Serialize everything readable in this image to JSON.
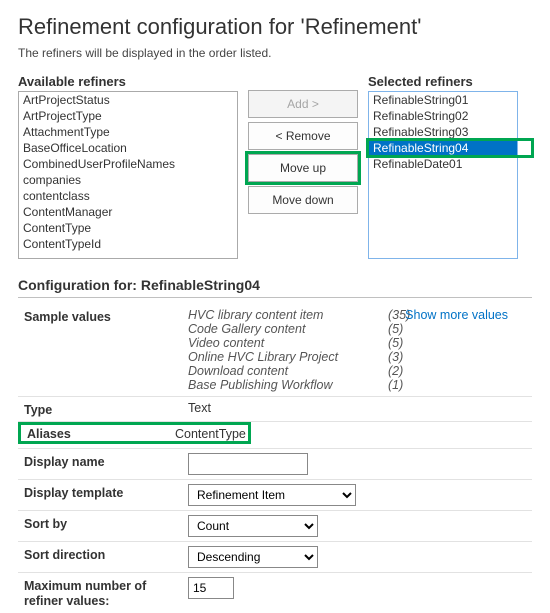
{
  "title": "Refinement configuration for 'Refinement'",
  "subtitle": "The refiners will be displayed in the order listed.",
  "picker": {
    "available_label": "Available refiners",
    "selected_label": "Selected refiners",
    "available": [
      "ArtProjectStatus",
      "ArtProjectType",
      "AttachmentType",
      "BaseOfficeLocation",
      "CombinedUserProfileNames",
      "companies",
      "contentclass",
      "ContentManager",
      "ContentType",
      "ContentTypeId"
    ],
    "selected": [
      "RefinableString01",
      "RefinableString02",
      "RefinableString03",
      "RefinableString04",
      "RefinableDate01"
    ],
    "selected_index": 3,
    "buttons": {
      "add": "Add >",
      "remove": "< Remove",
      "move_up": "Move up",
      "move_down": "Move down"
    }
  },
  "config": {
    "heading_prefix": "Configuration for:",
    "heading_value": "RefinableString04",
    "show_more": "Show more values",
    "labels": {
      "sample_values": "Sample values",
      "type": "Type",
      "aliases": "Aliases",
      "display_name": "Display name",
      "display_template": "Display template",
      "sort_by": "Sort by",
      "sort_direction": "Sort direction",
      "max_refiner": "Maximum number of refiner values:"
    },
    "samples": [
      {
        "name": "HVC library content item",
        "count": "(35)"
      },
      {
        "name": "Code Gallery content",
        "count": "(5)"
      },
      {
        "name": "Video content",
        "count": "(5)"
      },
      {
        "name": "Online HVC Library Project",
        "count": "(3)"
      },
      {
        "name": "Download content",
        "count": "(2)"
      },
      {
        "name": "Base Publishing Workflow",
        "count": "(1)"
      }
    ],
    "type_value": "Text",
    "aliases_value": "ContentType",
    "display_name_value": "",
    "display_template_value": "Refinement Item",
    "sort_by_value": "Count",
    "sort_direction_value": "Descending",
    "max_refiner_value": "15"
  }
}
